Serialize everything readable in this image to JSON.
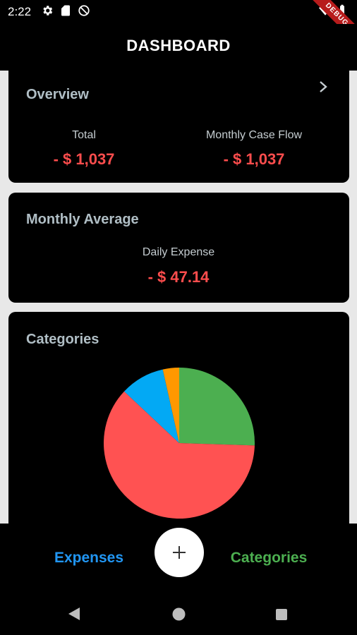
{
  "status_bar": {
    "time": "2:22",
    "icons_left": [
      "gear-icon",
      "sd-card-icon",
      "do-not-disturb-icon"
    ],
    "icons_right": [
      "wifi-icon",
      "battery-icon"
    ]
  },
  "debug_banner": "DEBUG",
  "app_bar": {
    "title": "DASHBOARD"
  },
  "overview": {
    "title": "Overview",
    "total_label": "Total",
    "total_value": "- $ 1,037",
    "cashflow_label": "Monthly Case Flow",
    "cashflow_value": "- $ 1,037"
  },
  "monthly_average": {
    "title": "Monthly Average",
    "daily_label": "Daily Expense",
    "daily_value": "- $ 47.14"
  },
  "categories_card": {
    "title": "Categories",
    "pie_colors": [
      "#4caf50",
      "#ff5252",
      "#03a9f4",
      "#ff9800"
    ],
    "pie_slices": [
      0.255,
      0.615,
      0.095,
      0.035
    ]
  },
  "bottom_nav": {
    "expenses_label": "Expenses",
    "categories_label": "Categories",
    "fab_symbol": "+"
  },
  "colors": {
    "negative": "#ff4d4d",
    "expenses_tab": "#2196f3",
    "categories_tab": "#4caf50",
    "card_title": "#b0bec5"
  }
}
